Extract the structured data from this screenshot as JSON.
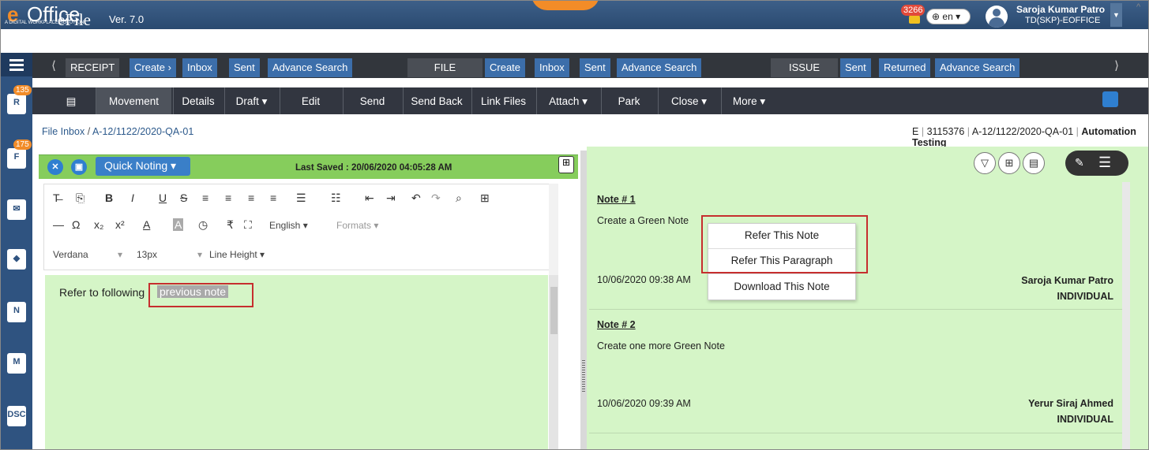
{
  "header": {
    "logo_e": "e",
    "logo_rest": "Office",
    "logo_sub": "A DIGITAL WORKPLACE SOLUTION",
    "app_name": "eFile",
    "app_version": "Ver. 7.0",
    "notification_count": "3266",
    "language": "en",
    "user_name": "Saroja Kumar Patro",
    "user_dept": "TD(SKP)-EOFFICE"
  },
  "sidebar": {
    "badges": [
      "135",
      "175"
    ],
    "icons": [
      "receipt-icon",
      "file-icon",
      "mail-icon",
      "dak-icon",
      "note-icon",
      "meeting-icon",
      "dsc-icon"
    ]
  },
  "nav": {
    "receipt": {
      "label": "RECEIPT",
      "items": [
        "Create",
        "Inbox",
        "Sent",
        "Advance Search"
      ]
    },
    "file": {
      "label": "FILE",
      "items": [
        "Create",
        "Inbox",
        "Sent",
        "Advance Search"
      ]
    },
    "issue": {
      "label": "ISSUE",
      "items": [
        "Sent",
        "Returned",
        "Advance Search"
      ]
    }
  },
  "actions": [
    "Movement",
    "Details",
    "Draft",
    "Edit",
    "Send",
    "Send Back",
    "Link Files",
    "Attach",
    "Park",
    "Close",
    "More"
  ],
  "breadcrumb": {
    "root": "File Inbox",
    "sep": "/",
    "current": "A-12/1122/2020-QA-01"
  },
  "fileinfo": {
    "type": "E",
    "number": "3115376",
    "file_no": "A-12/1122/2020-QA-01",
    "subject": "Automation Testing"
  },
  "editor": {
    "mode_label": "Quick Noting",
    "last_saved": "Last Saved : 20/06/2020 04:05:28 AM",
    "language": "English",
    "formats": "Formats",
    "font": "Verdana",
    "size": "13px",
    "line_height": "Line Height",
    "text_before": "Refer to following",
    "text_selected": "previous note"
  },
  "notes": [
    {
      "title": "Note # 1",
      "body": "Create a Green Note",
      "date": "10/06/2020 09:38 AM",
      "author": "Saroja Kumar Patro",
      "type": "INDIVIDUAL"
    },
    {
      "title": "Note # 2",
      "body": "Create one more Green Note",
      "date": "10/06/2020 09:39 AM",
      "author": "Yerur Siraj Ahmed",
      "type": "INDIVIDUAL"
    }
  ],
  "context_menu": [
    "Refer This Note",
    "Refer This Paragraph",
    "Download This Note"
  ]
}
